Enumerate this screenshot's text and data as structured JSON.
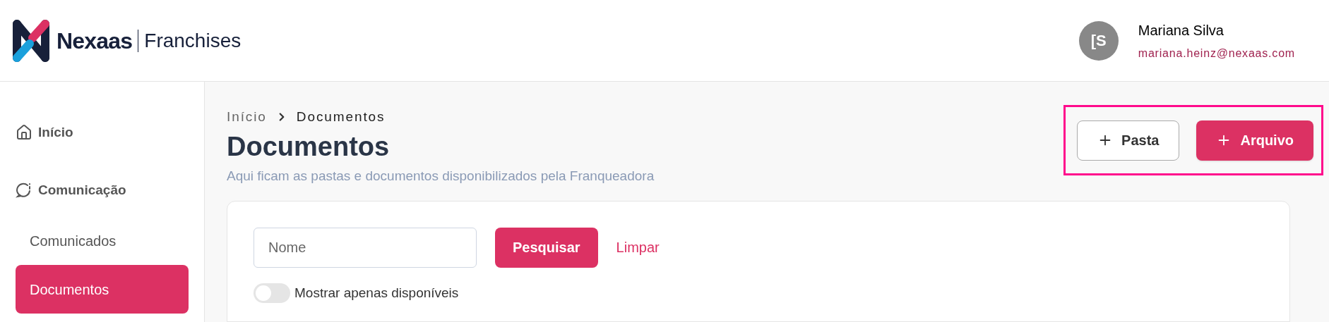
{
  "header": {
    "brand": "Nexaas",
    "product": "Franchises",
    "user": {
      "initials": "[S",
      "name": "Mariana Silva",
      "email": "mariana.heinz@nexaas.com"
    }
  },
  "sidebar": {
    "items": [
      {
        "label": "Início",
        "kind": "section",
        "selected": false
      },
      {
        "label": "Comunicação",
        "kind": "section",
        "selected": false
      },
      {
        "label": "Comunicados",
        "kind": "link",
        "selected": false
      },
      {
        "label": "Documentos",
        "kind": "link",
        "selected": true
      }
    ]
  },
  "breadcrumb": [
    "Início",
    "Documentos"
  ],
  "page": {
    "title": "Documentos",
    "subtitle": "Aqui ficam as pastas e documentos disponibilizados pela Franqueadora"
  },
  "actions": [
    {
      "label": "Pasta",
      "kind": "secondary"
    },
    {
      "label": "Arquivo",
      "kind": "primary"
    }
  ],
  "filters": {
    "search": {
      "placeholder": "Nome"
    },
    "search_button": "Pesquisar",
    "clear_link": "Limpar",
    "toggle": {
      "label": "Mostrar apenas disponíveis",
      "on": false
    }
  }
}
